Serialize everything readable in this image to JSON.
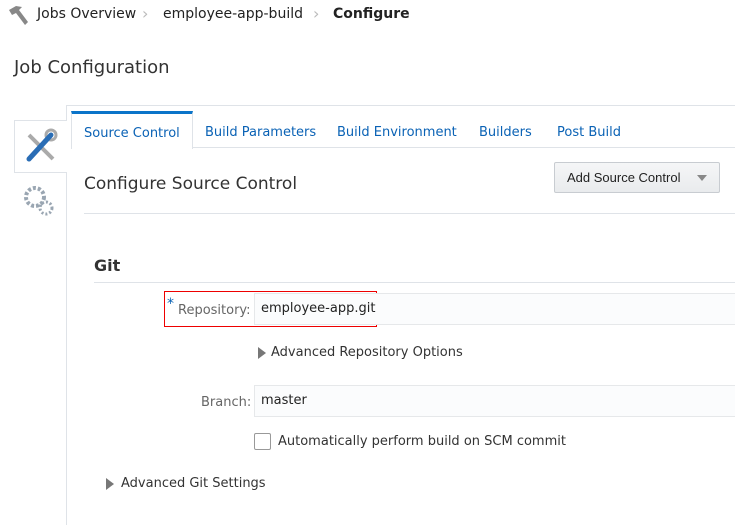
{
  "breadcrumb": {
    "items": [
      "Jobs Overview",
      "employee-app-build",
      "Configure"
    ]
  },
  "page_title": "Job Configuration",
  "tabs": [
    "Source Control",
    "Build Parameters",
    "Build Environment",
    "Builders",
    "Post Build"
  ],
  "section": {
    "title": "Configure Source Control",
    "add_button": "Add Source Control"
  },
  "git": {
    "title": "Git",
    "repository_label": "Repository:",
    "required_mark": "*",
    "repository_value": "employee-app.git",
    "advanced_repo": "Advanced Repository Options",
    "branch_label": "Branch:",
    "branch_value": "master",
    "auto_build_label": "Automatically perform build on SCM commit",
    "auto_build_checked": false,
    "advanced_git": "Advanced Git Settings"
  },
  "colors": {
    "accent": "#0a74c9",
    "highlight": "#ee0000"
  }
}
